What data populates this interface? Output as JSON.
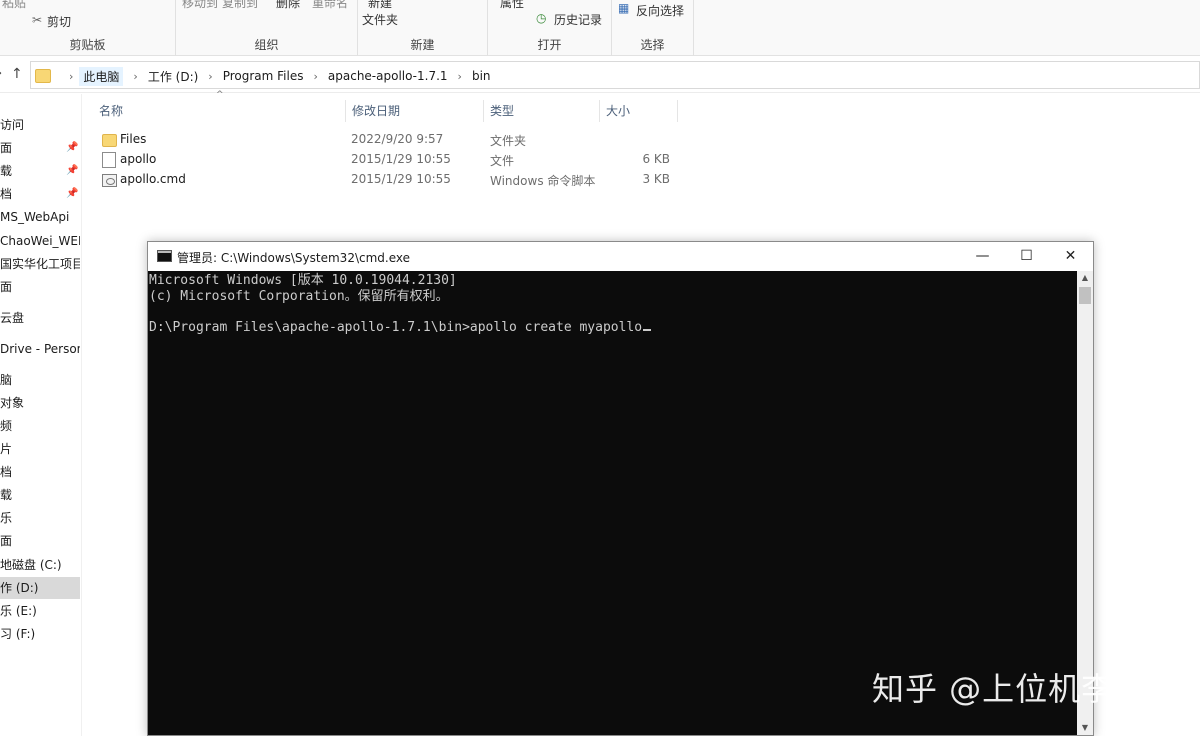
{
  "ribbon": {
    "clipboard": {
      "paste": "粘贴",
      "cut": "剪切",
      "label": "剪贴板"
    },
    "organize": {
      "move_to": "移动到",
      "copy_to": "复制到",
      "delete": "删除",
      "rename": "重命名",
      "label": "组织"
    },
    "new": {
      "new_top": "新建",
      "new_folder": "文件夹",
      "label": "新建"
    },
    "open": {
      "properties": "属性",
      "history": "历史记录",
      "label": "打开"
    },
    "select": {
      "invert": "反向选择",
      "label": "选择"
    }
  },
  "address": {
    "crumbs": [
      "此电脑",
      "工作 (D:)",
      "Program Files",
      "apache-apollo-1.7.1",
      "bin"
    ]
  },
  "sidebar": {
    "items": [
      "访问",
      "面",
      "载",
      "档",
      "MS_WebApi",
      "ChaoWei_WEB",
      "国实华化工项目材",
      "面",
      "云盘",
      "Drive - Persona",
      "脑",
      "对象",
      "频",
      "片",
      "档",
      "载",
      "乐",
      "面",
      "地磁盘 (C:)",
      "作 (D:)",
      "乐 (E:)",
      "习 (F:)"
    ]
  },
  "filelist": {
    "headers": {
      "name": "名称",
      "date": "修改日期",
      "type": "类型",
      "size": "大小"
    },
    "rows": [
      {
        "name": "Files",
        "date": "2022/9/20 9:57",
        "type": "文件夹",
        "size": "",
        "icon": "folder-icon"
      },
      {
        "name": "apollo",
        "date": "2015/1/29 10:55",
        "type": "文件",
        "size": "6 KB",
        "icon": "file-icon"
      },
      {
        "name": "apollo.cmd",
        "date": "2015/1/29 10:55",
        "type": "Windows 命令脚本",
        "size": "3 KB",
        "icon": "cmd-script-icon"
      }
    ]
  },
  "cmd": {
    "title": "管理员: C:\\Windows\\System32\\cmd.exe",
    "lines": [
      "Microsoft Windows [版本 10.0.19044.2130]",
      "(c) Microsoft Corporation。保留所有权利。",
      "",
      "D:\\Program Files\\apache-apollo-1.7.1\\bin>apollo create myapollo"
    ],
    "minimize": "—",
    "maximize": "☐",
    "close": "✕"
  },
  "watermark": "知乎 @上位机李工",
  "colors": {
    "accent": "#0078d7",
    "console_bg": "#0c0c0c",
    "console_fg": "#cccccc",
    "folder": "#f8d775"
  }
}
